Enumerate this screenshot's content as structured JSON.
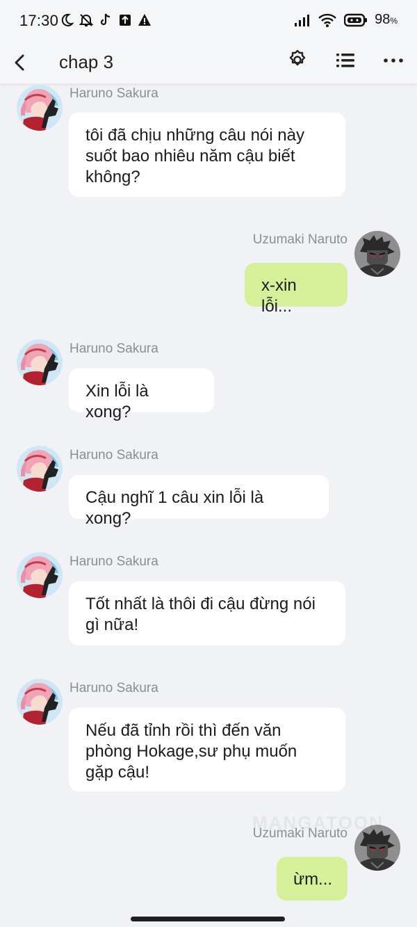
{
  "status_bar": {
    "time": "17:30",
    "battery": "98",
    "battery_unit": "%"
  },
  "header": {
    "title": "chap 3"
  },
  "messages": [
    {
      "sender": "Haruno Sakura",
      "side": "left",
      "lines": [
        "tôi đã chịu những câu nói này",
        "suốt bao nhiêu năm cậu biết",
        "không?"
      ]
    },
    {
      "sender": "Uzumaki Naruto",
      "side": "right",
      "lines": [
        "x-xin lỗi..."
      ]
    },
    {
      "sender": "Haruno Sakura",
      "side": "left",
      "lines": [
        "Xin lỗi là xong?"
      ]
    },
    {
      "sender": "Haruno Sakura",
      "side": "left",
      "lines": [
        "Cậu nghĩ 1 câu xin lỗi là xong?"
      ]
    },
    {
      "sender": "Haruno Sakura",
      "side": "left",
      "lines": [
        "Tốt nhất là thôi đi cậu đừng nói",
        "gì nữa!"
      ]
    },
    {
      "sender": "Haruno Sakura",
      "side": "left",
      "lines": [
        "Nếu đã tỉnh rồi thì đến văn",
        "phòng Hokage,sư phụ muốn",
        "gặp cậu!"
      ]
    },
    {
      "sender": "Uzumaki Naruto",
      "side": "right",
      "lines": [
        "ừm..."
      ]
    }
  ],
  "watermark": "MANGATOON",
  "colors": {
    "background": "#f1f2f5",
    "right_bubble": "#d6f09a",
    "left_bubble": "#ffffff",
    "name_text": "#8a8d93"
  }
}
